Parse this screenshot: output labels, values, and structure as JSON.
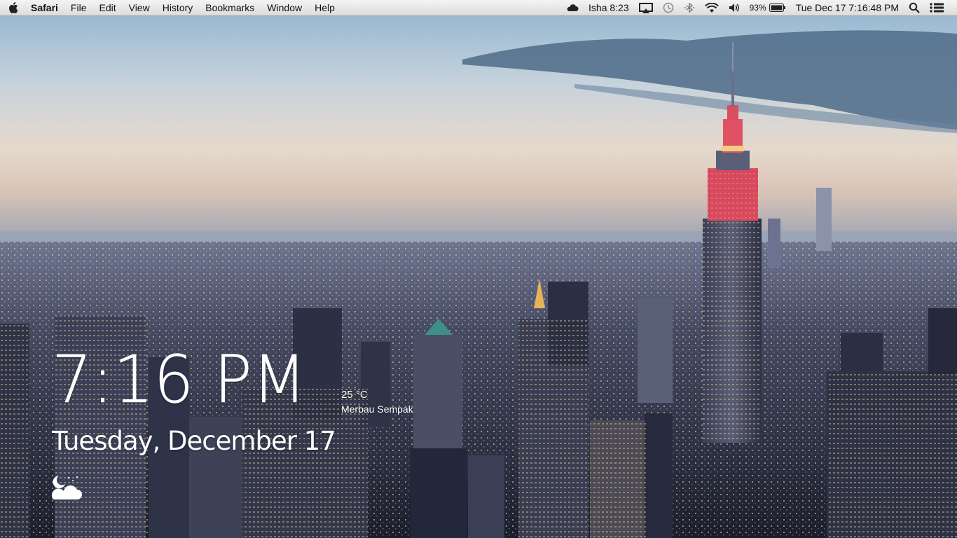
{
  "menubar": {
    "apple_icon": "apple-icon",
    "app_name": "Safari",
    "menus": [
      "File",
      "Edit",
      "View",
      "History",
      "Bookmarks",
      "Window",
      "Help"
    ],
    "prayer": "Isha 8:23",
    "battery_percent": "93%",
    "datetime": "Tue Dec 17  7:16:48 PM",
    "status_icons": [
      "cloud-icon",
      "airplay-icon",
      "time-machine-icon",
      "bluetooth-icon",
      "wifi-icon",
      "volume-icon",
      "battery-icon",
      "spotlight-icon",
      "notification-center-icon"
    ]
  },
  "widget": {
    "time": "7:16 PM",
    "date": "Tuesday, December 17",
    "temperature": "25 °C",
    "location": "Merbau Sempak",
    "weather_icon": "moon-cloud-icon"
  }
}
